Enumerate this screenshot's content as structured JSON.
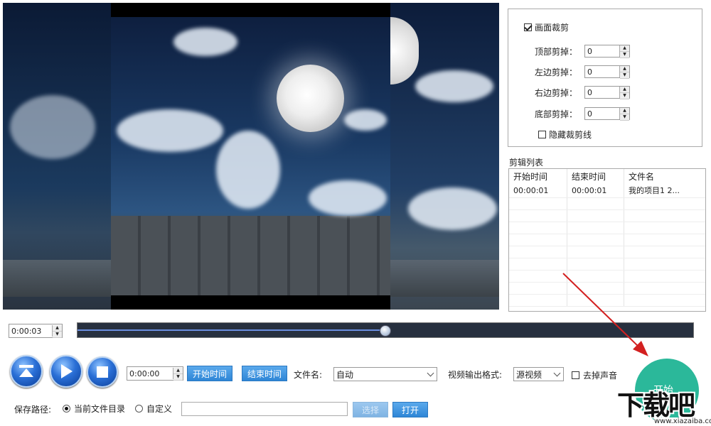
{
  "crop": {
    "enable_label": "画面裁剪",
    "enable_checked": true,
    "fields": [
      {
        "label": "顶部剪掉：",
        "value": "0"
      },
      {
        "label": "左边剪掉：",
        "value": "0"
      },
      {
        "label": "右边剪掉：",
        "value": "0"
      },
      {
        "label": "底部剪掉：",
        "value": "0"
      }
    ],
    "hide_lines_label": "隐藏裁剪线",
    "hide_lines_checked": false
  },
  "clip_list": {
    "title": "剪辑列表",
    "columns": [
      "开始时间",
      "结束时间",
      "文件名"
    ],
    "rows": [
      {
        "start": "00:00:01",
        "end": "00:00:01",
        "file": "我的项目1 2..."
      }
    ]
  },
  "timeline": {
    "current_time": "0:00:03",
    "progress": 0.499
  },
  "controls": {
    "clip_time": "0:00:00",
    "start_time_label": "开始时间",
    "end_time_label": "结束时间",
    "filename_label": "文件名:",
    "filename_value": "自动",
    "format_label": "视频输出格式:",
    "format_value": "源视频",
    "remove_audio_label": "去掉声音",
    "remove_audio_checked": false
  },
  "save": {
    "label": "保存路径:",
    "option_current": "当前文件目录",
    "option_custom": "自定义",
    "selected": "current",
    "path_value": "",
    "choose_label": "选择",
    "open_label": "打开"
  },
  "start_button_label": "开始",
  "watermark": {
    "logo_text": "下载吧",
    "url": "www.xiazaiba.com"
  },
  "colors": {
    "accent_blue": "#2f86d6",
    "start_green": "#2bb89a",
    "annotation_arrow": "#d32020"
  }
}
